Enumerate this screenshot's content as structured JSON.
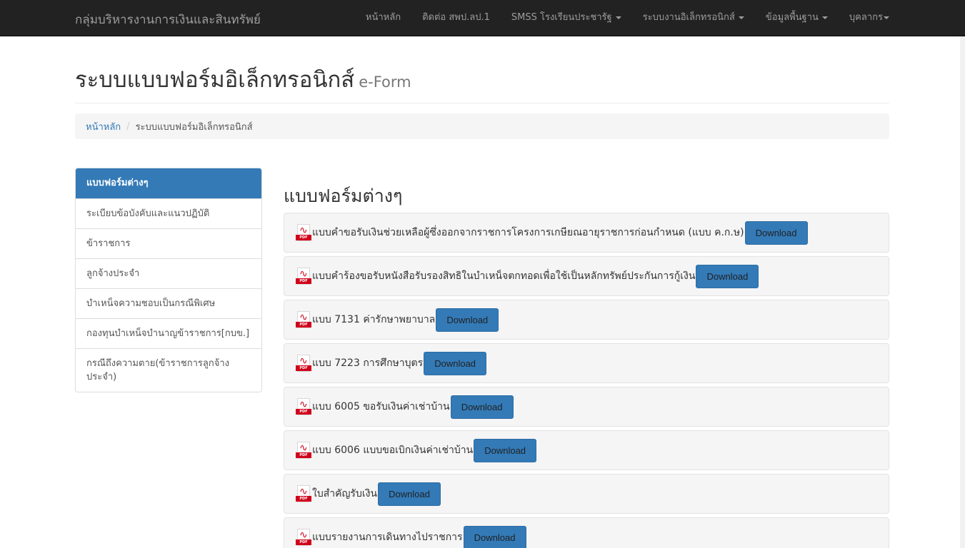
{
  "navbar": {
    "brand": "กลุ่มบริหารงานการเงินและสินทรัพย์",
    "links": [
      {
        "label": "หน้าหลัก",
        "dropdown": false
      },
      {
        "label": "ติดต่อ สพป.ลป.1",
        "dropdown": false
      },
      {
        "label": "SMSS โรงเรียนประชารัฐ",
        "dropdown": true
      },
      {
        "label": "ระบบงานอิเล็กทรอนิกส์",
        "dropdown": true
      },
      {
        "label": "ข้อมูลพื้นฐาน",
        "dropdown": true
      },
      {
        "label": "บุคลากร",
        "dropdown": true
      }
    ]
  },
  "header": {
    "title": "ระบบแบบฟอร์มอิเล็กทรอนิกส์",
    "subtitle": "e-Form"
  },
  "breadcrumb": {
    "home": "หน้าหลัก",
    "separator": "/",
    "current": "ระบบแบบฟอร์มอิเล็กทรอนิกส์"
  },
  "sidebar": {
    "items": [
      {
        "label": "แบบฟอร์มต่างๆ",
        "active": true
      },
      {
        "label": "ระเบียบข้อบังคับและแนวปฏิบัติ",
        "active": false
      },
      {
        "label": "ข้าราชการ",
        "active": false
      },
      {
        "label": "ลูกจ้างประจำ",
        "active": false
      },
      {
        "label": "บำเหน็จความชอบเป็นกรณีพิเศษ",
        "active": false
      },
      {
        "label": "กองทุนบำเหน็จบำนาญข้าราชการ[กบข.]",
        "active": false
      },
      {
        "label": "กรณีถึงความตาย(ข้าราชการลูกจ้างประจำ)",
        "active": false
      }
    ]
  },
  "main": {
    "title": "แบบฟอร์มต่างๆ",
    "icon_tag": "PDF",
    "download_label": "Download",
    "forms": [
      {
        "label": "แบบคำขอรับเงินช่วยเหลือผู้ซึ่งออกจากราชการโครงการเกษียณอายุราชการก่อนกำหนด (แบบ ค.ก.ษ)"
      },
      {
        "label": "แบบคำร้องขอรับหนังสือรับรองสิทธิในบำเหน็จตกทอดเพื่อใช้เป็นหลักทรัพย์ประกันการกู้เงิน"
      },
      {
        "label": "แบบ 7131 ค่ารักษาพยาบาล"
      },
      {
        "label": "แบบ 7223 การศึกษาบุตร"
      },
      {
        "label": "แบบ 6005 ขอรับเงินค่าเช่าบ้าน"
      },
      {
        "label": "แบบ 6006 แบบขอเบิกเงินค่าเช่าบ้าน"
      },
      {
        "label": "ใบสำคัญรับเงิน"
      },
      {
        "label": "แบบรายงานการเดินทางไปราชการ"
      }
    ]
  },
  "colors": {
    "navbar_bg": "#222222",
    "primary": "#337ab7",
    "panel_bg": "#f5f5f5"
  }
}
